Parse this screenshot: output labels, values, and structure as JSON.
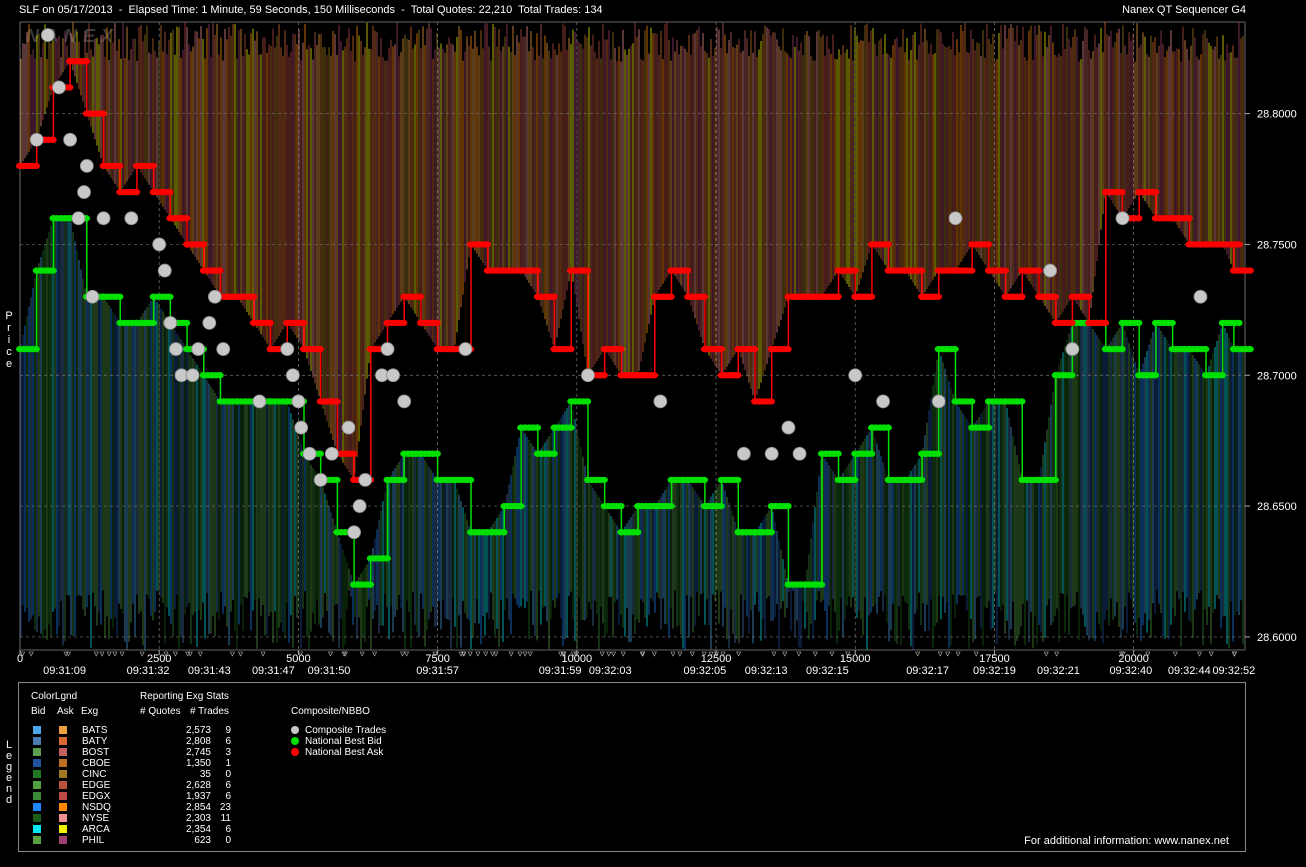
{
  "header": {
    "title_left": "SLF on 05/17/2013  -  Elapsed Time: 1 Minute, 59 Seconds, 150 Milliseconds  -  Total Quotes: 22,210  Total Trades: 134",
    "title_right": "Nanex QT Sequencer G4",
    "watermark": "NANEX"
  },
  "axis": {
    "price_label": "Price",
    "legend_side_label": "Legend"
  },
  "chart_data": {
    "type": "line",
    "title": "SLF on 05/17/2013",
    "ylim": [
      28.595,
      28.835
    ],
    "xlim": [
      0,
      22000
    ],
    "y_ticks": [
      "28.6000",
      "28.6500",
      "28.7000",
      "28.7500",
      "28.8000"
    ],
    "x_ticks": [
      "0",
      "2500",
      "5000",
      "7500",
      "10000",
      "12500",
      "15000",
      "17500",
      "20000"
    ],
    "time_labels": [
      {
        "x": 800,
        "label": "09:31:09"
      },
      {
        "x": 2300,
        "label": "09:31:32"
      },
      {
        "x": 3400,
        "label": "09:31:43"
      },
      {
        "x": 4550,
        "label": "09:31:47"
      },
      {
        "x": 5550,
        "label": "09:31:50"
      },
      {
        "x": 7500,
        "label": "09:31:57"
      },
      {
        "x": 9700,
        "label": "09:31:59"
      },
      {
        "x": 10600,
        "label": "09:32:03"
      },
      {
        "x": 12300,
        "label": "09:32:05"
      },
      {
        "x": 13400,
        "label": "09:32:13"
      },
      {
        "x": 14500,
        "label": "09:32:15"
      },
      {
        "x": 16300,
        "label": "09:32:17"
      },
      {
        "x": 17500,
        "label": "09:32:19"
      },
      {
        "x": 18650,
        "label": "09:32:21"
      },
      {
        "x": 19950,
        "label": "09:32:40"
      },
      {
        "x": 21000,
        "label": "09:32:44"
      },
      {
        "x": 21800,
        "label": "09:32:52"
      }
    ],
    "series": [
      {
        "name": "National Best Bid",
        "color": "#00e000",
        "x": [
          0,
          300,
          600,
          900,
          1200,
          1500,
          1800,
          2100,
          2400,
          2700,
          3000,
          3300,
          3600,
          3900,
          4200,
          4500,
          4800,
          5100,
          5400,
          5700,
          6000,
          6300,
          6600,
          6900,
          7200,
          7500,
          7800,
          8100,
          8400,
          8700,
          9000,
          9300,
          9600,
          9900,
          10200,
          10500,
          10800,
          11100,
          11400,
          11700,
          12000,
          12300,
          12600,
          12900,
          13200,
          13500,
          13800,
          14100,
          14400,
          14700,
          15000,
          15300,
          15600,
          15900,
          16200,
          16500,
          16800,
          17100,
          17400,
          17700,
          18000,
          18300,
          18600,
          18900,
          19200,
          19500,
          19800,
          20100,
          20400,
          20700,
          21000,
          21300,
          21600,
          21800
        ],
        "values": [
          28.71,
          28.74,
          28.76,
          28.76,
          28.73,
          28.73,
          28.72,
          28.72,
          28.73,
          28.72,
          28.71,
          28.7,
          28.69,
          28.69,
          28.69,
          28.69,
          28.69,
          28.67,
          28.66,
          28.64,
          28.62,
          28.63,
          28.66,
          28.67,
          28.67,
          28.66,
          28.66,
          28.64,
          28.64,
          28.65,
          28.68,
          28.67,
          28.68,
          28.69,
          28.66,
          28.65,
          28.64,
          28.65,
          28.65,
          28.66,
          28.66,
          28.65,
          28.66,
          28.64,
          28.64,
          28.65,
          28.62,
          28.62,
          28.67,
          28.66,
          28.67,
          28.68,
          28.66,
          28.66,
          28.67,
          28.71,
          28.69,
          28.68,
          28.69,
          28.69,
          28.66,
          28.66,
          28.7,
          28.72,
          28.72,
          28.71,
          28.72,
          28.7,
          28.72,
          28.71,
          28.71,
          28.7,
          28.72,
          28.71
        ]
      },
      {
        "name": "National Best Ask",
        "color": "#ff0000",
        "x": [
          0,
          300,
          600,
          900,
          1200,
          1500,
          1800,
          2100,
          2400,
          2700,
          3000,
          3300,
          3600,
          3900,
          4200,
          4500,
          4800,
          5100,
          5400,
          5700,
          6000,
          6300,
          6600,
          6900,
          7200,
          7500,
          7800,
          8100,
          8400,
          8700,
          9000,
          9300,
          9600,
          9900,
          10200,
          10500,
          10800,
          11100,
          11400,
          11700,
          12000,
          12300,
          12600,
          12900,
          13200,
          13500,
          13800,
          14100,
          14400,
          14700,
          15000,
          15300,
          15600,
          15900,
          16200,
          16500,
          16800,
          17100,
          17400,
          17700,
          18000,
          18300,
          18600,
          18900,
          19200,
          19500,
          19800,
          20100,
          20400,
          20700,
          21000,
          21300,
          21600,
          21800
        ],
        "values": [
          28.78,
          28.79,
          28.81,
          28.82,
          28.8,
          28.78,
          28.77,
          28.78,
          28.77,
          28.76,
          28.75,
          28.74,
          28.73,
          28.73,
          28.72,
          28.71,
          28.72,
          28.71,
          28.69,
          28.67,
          28.66,
          28.71,
          28.72,
          28.73,
          28.72,
          28.71,
          28.71,
          28.75,
          28.74,
          28.74,
          28.74,
          28.73,
          28.71,
          28.74,
          28.7,
          28.71,
          28.7,
          28.7,
          28.73,
          28.74,
          28.73,
          28.71,
          28.7,
          28.71,
          28.69,
          28.71,
          28.73,
          28.73,
          28.73,
          28.74,
          28.73,
          28.75,
          28.74,
          28.74,
          28.73,
          28.74,
          28.74,
          28.75,
          28.74,
          28.73,
          28.74,
          28.73,
          28.72,
          28.73,
          28.72,
          28.77,
          28.76,
          28.77,
          28.76,
          28.76,
          28.75,
          28.75,
          28.75,
          28.74
        ]
      },
      {
        "name": "Composite Trades",
        "color": "#c8c8c8",
        "x": [
          300,
          500,
          700,
          900,
          1050,
          1150,
          1200,
          1300,
          1500,
          2000,
          2500,
          2600,
          2700,
          2800,
          2900,
          3100,
          3200,
          3400,
          3500,
          3650,
          4300,
          4800,
          4900,
          5000,
          5050,
          5200,
          5400,
          5600,
          5900,
          6000,
          6100,
          6200,
          6500,
          6600,
          6700,
          6900,
          8000,
          10200,
          11500,
          13000,
          13500,
          13800,
          14000,
          15000,
          15500,
          16500,
          16800,
          18500,
          18900,
          19800,
          21200
        ],
        "values": [
          28.79,
          28.83,
          28.81,
          28.79,
          28.76,
          28.77,
          28.78,
          28.73,
          28.76,
          28.76,
          28.75,
          28.74,
          28.72,
          28.71,
          28.7,
          28.7,
          28.71,
          28.72,
          28.73,
          28.71,
          28.69,
          28.71,
          28.7,
          28.69,
          28.68,
          28.67,
          28.66,
          28.67,
          28.68,
          28.64,
          28.65,
          28.66,
          28.7,
          28.71,
          28.7,
          28.69,
          28.71,
          28.7,
          28.69,
          28.67,
          28.67,
          28.68,
          28.67,
          28.7,
          28.69,
          28.69,
          28.76,
          28.74,
          28.71,
          28.76,
          28.73
        ]
      }
    ]
  },
  "legend": {
    "col_headers": {
      "colorlgnd": "ColorLgnd",
      "bid": "Bid",
      "ask": "Ask",
      "exg": "Exg",
      "reporting": "Reporting Exg Stats",
      "quotes": "# Quotes",
      "trades": "# Trades",
      "composite": "Composite/NBBO"
    },
    "rows": [
      {
        "exg": "BATS",
        "quotes": "2,573",
        "trades": "9",
        "bid": "#4aa6e8",
        "ask": "#f0a040"
      },
      {
        "exg": "BATY",
        "quotes": "2,808",
        "trades": "6",
        "bid": "#4a7ab0",
        "ask": "#d86a30"
      },
      {
        "exg": "BOST",
        "quotes": "2,745",
        "trades": "3",
        "bid": "#5aa050",
        "ask": "#c06060"
      },
      {
        "exg": "CBOE",
        "quotes": "1,350",
        "trades": "1",
        "bid": "#2050a0",
        "ask": "#c07020"
      },
      {
        "exg": "CINC",
        "quotes": "35",
        "trades": "0",
        "bid": "#207820",
        "ask": "#a07820"
      },
      {
        "exg": "EDGE",
        "quotes": "2,628",
        "trades": "6",
        "bid": "#50a040",
        "ask": "#b85040"
      },
      {
        "exg": "EDGX",
        "quotes": "1,937",
        "trades": "6",
        "bid": "#3a8a3a",
        "ask": "#c04a4a"
      },
      {
        "exg": "NSDQ",
        "quotes": "2,854",
        "trades": "23",
        "bid": "#1e88ff",
        "ask": "#ff8800"
      },
      {
        "exg": "NYSE",
        "quotes": "2,303",
        "trades": "11",
        "bid": "#1a5e1a",
        "ask": "#f09090"
      },
      {
        "exg": "ARCA",
        "quotes": "2,354",
        "trades": "6",
        "bid": "#00e8f0",
        "ask": "#f0f000"
      },
      {
        "exg": "PHIL",
        "quotes": "623",
        "trades": "0",
        "bid": "#58a040",
        "ask": "#a04070"
      }
    ],
    "composite_items": [
      {
        "label": "Composite Trades",
        "color": "#c8c8c8"
      },
      {
        "label": "National Best Bid",
        "color": "#00e000"
      },
      {
        "label": "National Best Ask",
        "color": "#ff0000"
      }
    ]
  },
  "footer": {
    "info": "For additional information: www.nanex.net"
  }
}
